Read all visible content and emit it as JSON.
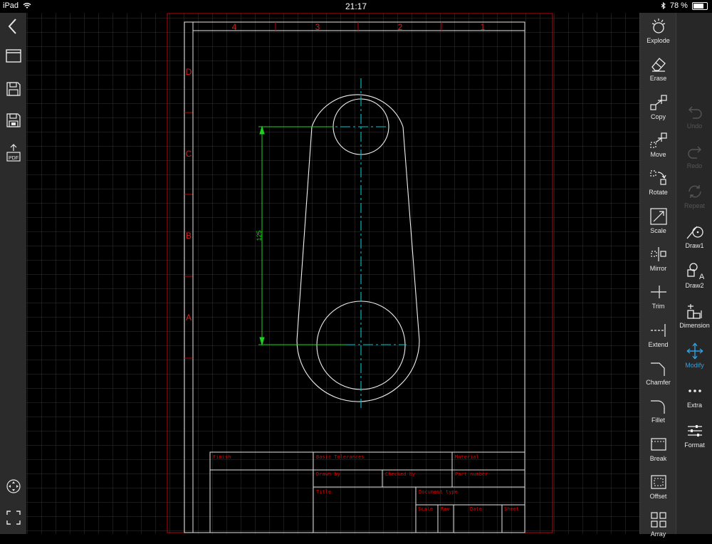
{
  "status_bar": {
    "device": "iPad",
    "time": "21:17",
    "battery": "78 %"
  },
  "left_toolbar": {
    "icons": [
      "back-icon",
      "layers-icon",
      "save-icon",
      "save-as-icon",
      "export-pdf-icon",
      "pan-icon",
      "fullscreen-icon"
    ],
    "pdf_label": "PDF"
  },
  "modify_tools": [
    {
      "label": "Explode",
      "icon": "explode-icon"
    },
    {
      "label": "Erase",
      "icon": "erase-icon"
    },
    {
      "label": "Copy",
      "icon": "copy-icon"
    },
    {
      "label": "Move",
      "icon": "move-icon"
    },
    {
      "label": "Rotate",
      "icon": "rotate-icon"
    },
    {
      "label": "Scale",
      "icon": "scale-icon"
    },
    {
      "label": "Mirror",
      "icon": "mirror-icon"
    },
    {
      "label": "Trim",
      "icon": "trim-icon"
    },
    {
      "label": "Extend",
      "icon": "extend-icon"
    },
    {
      "label": "Chamfer",
      "icon": "chamfer-icon"
    },
    {
      "label": "Fillet",
      "icon": "fillet-icon"
    },
    {
      "label": "Break",
      "icon": "break-icon"
    },
    {
      "label": "Offset",
      "icon": "offset-icon"
    },
    {
      "label": "Array",
      "icon": "array-icon"
    }
  ],
  "main_tools": [
    {
      "label": "Undo",
      "icon": "undo-icon",
      "enabled": false
    },
    {
      "label": "Redo",
      "icon": "redo-icon",
      "enabled": false
    },
    {
      "label": "Repeat",
      "icon": "repeat-icon",
      "enabled": false
    },
    {
      "label": "Draw1",
      "icon": "draw1-icon",
      "enabled": true
    },
    {
      "label": "Draw2",
      "icon": "draw2-icon",
      "enabled": true
    },
    {
      "label": "Dimension",
      "icon": "dimension-icon",
      "enabled": true
    },
    {
      "label": "Modify",
      "icon": "modify-icon",
      "enabled": true,
      "active": true
    },
    {
      "label": "Extra",
      "icon": "extra-icon",
      "enabled": true
    },
    {
      "label": "Format",
      "icon": "format-icon",
      "enabled": true
    }
  ],
  "drawing": {
    "column_zones": [
      "4",
      "3",
      "2",
      "1"
    ],
    "row_zones": [
      "D",
      "C",
      "B",
      "A"
    ],
    "dimension_value": "125",
    "title_block": {
      "finish": "Finish",
      "basic_tolerances": "Basic Tolerances",
      "material": "Material",
      "drawn_by": "Drawn by",
      "checked_by": "Checked by",
      "part_number": "Part number",
      "title": "Title",
      "document_type": "Document type",
      "scale": "Scale",
      "rev": "Rev",
      "date": "Date",
      "sheet": "Sheet"
    },
    "colors": {
      "sheet_border": "#c00000",
      "frame": "#e6e6e6",
      "grid": "#333333",
      "part_outline": "#f0f0f0",
      "centerline": "#00c8d0",
      "dimension": "#20d020",
      "title_text": "#e00000"
    }
  }
}
